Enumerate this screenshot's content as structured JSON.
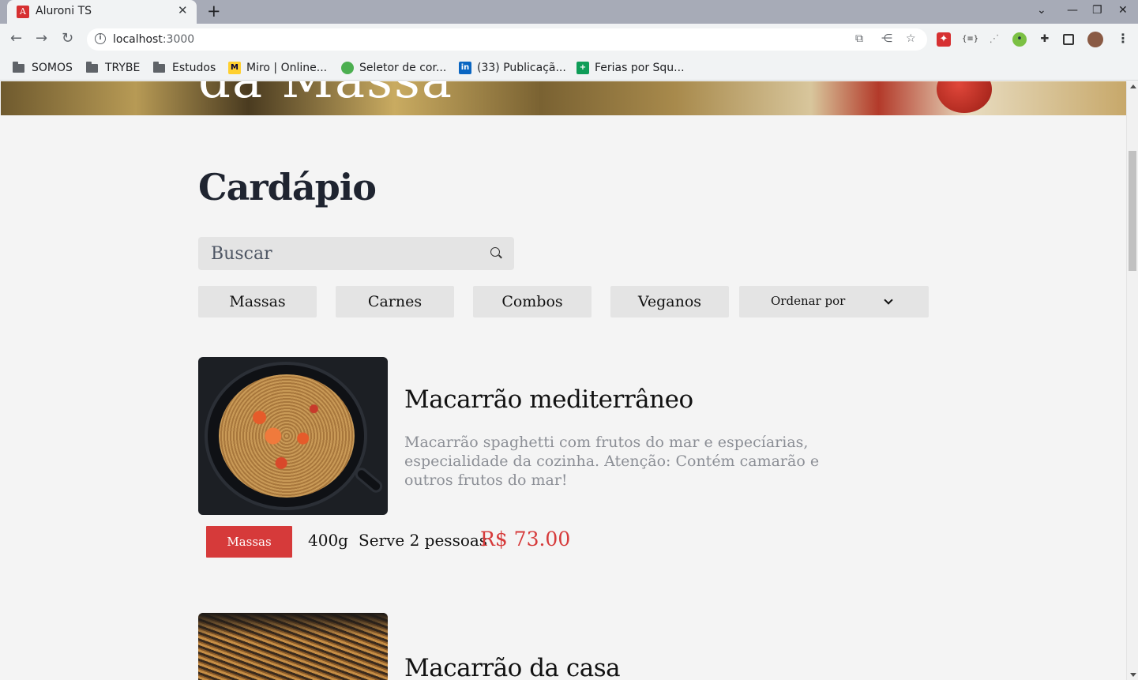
{
  "browser": {
    "tab_title": "Aluroni TS",
    "tab_favicon_letter": "A",
    "url_host": "localhost",
    "url_port": ":3000",
    "bookmarks": [
      {
        "label": "SOMOS",
        "icon": "folder-icon"
      },
      {
        "label": "TRYBE",
        "icon": "folder-icon"
      },
      {
        "label": "Estudos",
        "icon": "folder-icon"
      },
      {
        "label": "Miro | Online...",
        "icon": "miro-icon"
      },
      {
        "label": "Seletor de cor...",
        "icon": "color-picker-icon"
      },
      {
        "label": "(33) Publicaçã...",
        "icon": "linkedin-icon"
      },
      {
        "label": "Ferias por Squ...",
        "icon": "sheets-icon"
      }
    ]
  },
  "hero": {
    "text": "da Massa"
  },
  "menu": {
    "title": "Cardápio",
    "search_placeholder": "Buscar",
    "filters": [
      "Massas",
      "Carnes",
      "Combos",
      "Veganos"
    ],
    "sort_label": "Ordenar por"
  },
  "items": [
    {
      "name": "Macarrão mediterrâneo",
      "description": "Macarrão spaghetti com frutos do mar e especíarias, especialidade da cozinha. Atenção: Contém camarão e outros frutos do mar!",
      "category": "Massas",
      "weight": "400g",
      "serves": "Serve 2 pessoas",
      "price": "R$ 73.00"
    },
    {
      "name": "Macarrão da casa"
    }
  ],
  "colors": {
    "accent": "#d63a3a",
    "page_bg": "#f4f4f4",
    "control_bg": "#e4e4e4",
    "title": "#1f2430"
  }
}
